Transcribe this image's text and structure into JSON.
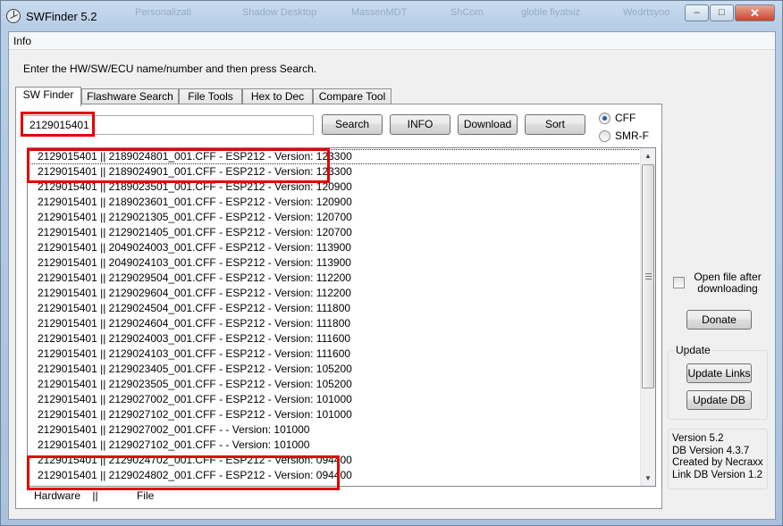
{
  "window": {
    "title": "SWFinder 5.2",
    "ghost_titles": [
      "Personalizati",
      "Shadow Desktop",
      "MassenMDT",
      "ShCom",
      "globle fiyatsiz",
      "Wedrtsyoo"
    ],
    "controls": {
      "minimize": "–",
      "maximize": "□",
      "close": "✕"
    }
  },
  "menu": {
    "info": "Info"
  },
  "instructions": "Enter the HW/SW/ECU name/number and then press Search.",
  "tabs": [
    {
      "label": "SW Finder",
      "active": true
    },
    {
      "label": "Flashware Search",
      "active": false
    },
    {
      "label": "File Tools",
      "active": false
    },
    {
      "label": "Hex to Dec",
      "active": false
    },
    {
      "label": "Compare Tool",
      "active": false
    }
  ],
  "search": {
    "value": "2129015401"
  },
  "buttons": {
    "search": "Search",
    "info": "INFO",
    "download": "Download",
    "sort": "Sort",
    "donate": "Donate",
    "update_links": "Update Links",
    "update_db": "Update DB"
  },
  "format_options": {
    "cff": "CFF",
    "smr": "SMR-F",
    "selected": "CFF"
  },
  "results": [
    "2129015401 || 2189024801_001.CFF - ESP212 - Version: 123300",
    "2129015401 || 2189024901_001.CFF - ESP212 - Version: 123300",
    "2129015401 || 2189023501_001.CFF - ESP212 - Version: 120900",
    "2129015401 || 2189023601_001.CFF - ESP212 - Version: 120900",
    "2129015401 || 2129021305_001.CFF - ESP212 - Version: 120700",
    "2129015401 || 2129021405_001.CFF - ESP212 - Version: 120700",
    "2129015401 || 2049024003_001.CFF - ESP212 - Version: 113900",
    "2129015401 || 2049024103_001.CFF - ESP212 - Version: 113900",
    "2129015401 || 2129029504_001.CFF - ESP212 - Version: 112200",
    "2129015401 || 2129029604_001.CFF - ESP212 - Version: 112200",
    "2129015401 || 2129024504_001.CFF - ESP212 - Version: 111800",
    "2129015401 || 2129024604_001.CFF - ESP212 - Version: 111800",
    "2129015401 || 2129024003_001.CFF - ESP212 - Version: 111600",
    "2129015401 || 2129024103_001.CFF - ESP212 - Version: 111600",
    "2129015401 || 2129023405_001.CFF - ESP212 - Version: 105200",
    "2129015401 || 2129023505_001.CFF - ESP212 - Version: 105200",
    "2129015401 || 2129027002_001.CFF - ESP212 - Version: 101000",
    "2129015401 || 2129027102_001.CFF - ESP212 - Version: 101000",
    "2129015401 || 2129027002_001.CFF -  - Version: 101000",
    "2129015401 || 2129027102_001.CFF -  - Version: 101000",
    "2129015401 || 2129024702_001.CFF - ESP212 - Version: 094400",
    "2129015401 || 2129024802_001.CFF - ESP212 - Version: 094400"
  ],
  "list_footer": {
    "hardware": "Hardware",
    "separator": "||",
    "file": "File"
  },
  "options": {
    "open_file_after_downloading": "Open file after downloading",
    "checked": false
  },
  "update_group": {
    "title": "Update"
  },
  "version_info": {
    "version": "Version 5.2",
    "db_version": "DB Version 4.3.7",
    "created_by": "Created by Necraxx",
    "link_db_version": "Link DB Version 1.2"
  },
  "colors": {
    "highlight": "#e00000",
    "titlebar": "#b6cde6",
    "close_button": "#c9452b"
  }
}
